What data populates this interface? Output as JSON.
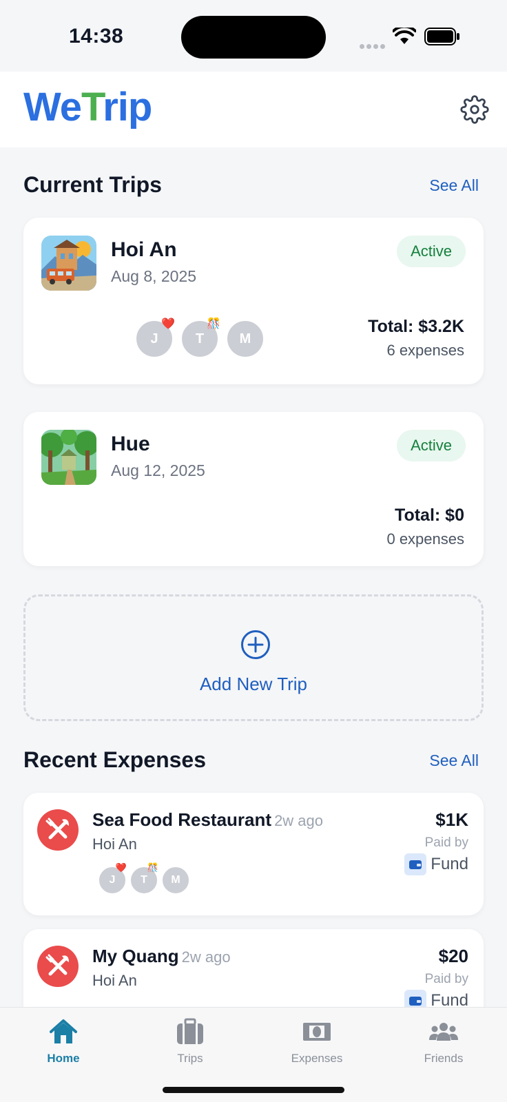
{
  "status_bar": {
    "time": "14:38"
  },
  "header": {
    "logo_we": "We",
    "logo_t": "T",
    "logo_rip": "rip",
    "settings_icon": "gear-icon"
  },
  "current_trips": {
    "title": "Current Trips",
    "see_all": "See All",
    "trips": [
      {
        "name": "Hoi An",
        "date": "Aug 8, 2025",
        "status": "Active",
        "total": "Total: $3.2K",
        "expenses": "6 expenses",
        "members": [
          {
            "initial": "J",
            "emoji": "❤️"
          },
          {
            "initial": "T",
            "emoji": "🎊"
          },
          {
            "initial": "M",
            "emoji": ""
          }
        ]
      },
      {
        "name": "Hue",
        "date": "Aug 12, 2025",
        "status": "Active",
        "total": "Total: $0",
        "expenses": "0 expenses",
        "members": []
      }
    ],
    "add_new_trip": "Add New Trip"
  },
  "recent_expenses": {
    "title": "Recent Expenses",
    "see_all": "See All",
    "items": [
      {
        "title": "Sea Food Restaurant",
        "ago": "2w ago",
        "trip": "Hoi An",
        "amount": "$1K",
        "paid_by_label": "Paid by",
        "paid_by": "Fund",
        "members": [
          {
            "initial": "J",
            "emoji": "❤️"
          },
          {
            "initial": "T",
            "emoji": "🎊"
          },
          {
            "initial": "M",
            "emoji": ""
          }
        ]
      },
      {
        "title": "My Quang",
        "ago": "2w ago",
        "trip": "Hoi An",
        "amount": "$20",
        "paid_by_label": "Paid by",
        "paid_by": "Fund"
      }
    ]
  },
  "tab_bar": {
    "tabs": [
      {
        "label": "Home",
        "icon": "home-icon",
        "active": true
      },
      {
        "label": "Trips",
        "icon": "suitcase-icon",
        "active": false
      },
      {
        "label": "Expenses",
        "icon": "cash-icon",
        "active": false
      },
      {
        "label": "Friends",
        "icon": "people-icon",
        "active": false
      }
    ]
  },
  "colors": {
    "accent": "#1f5fbf",
    "active_tab": "#1b7fa6",
    "status_green": "#15803d",
    "expense_red": "#ea4b4b"
  }
}
